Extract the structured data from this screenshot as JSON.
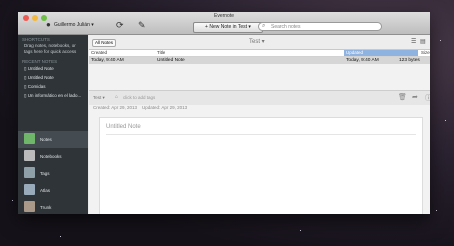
{
  "window": {
    "title": "Evernote"
  },
  "toolbar": {
    "account_label": "Guillermo Julián ▾",
    "new_note_label": "+ New Note in Test ▾",
    "search_placeholder": "Search notes",
    "search_icon": "search-icon",
    "sync_icon": "sync-icon",
    "activity_icon": "activity-icon"
  },
  "sidebar": {
    "shortcuts_header": "SHORTCUTS",
    "shortcuts_help": "Drag notes, notebooks, or tags here for quick access",
    "recent_header": "RECENT NOTES",
    "recent_notes": [
      {
        "label": "Untitled Note"
      },
      {
        "label": "Untitled Note"
      },
      {
        "label": "Comidas"
      },
      {
        "label": "Un informático en el lado..."
      }
    ],
    "nav": [
      {
        "label": "Notes"
      },
      {
        "label": "Notebooks"
      },
      {
        "label": "Tags"
      },
      {
        "label": "Atlas"
      },
      {
        "label": "Trunk"
      }
    ]
  },
  "list": {
    "filter_label": "All Notes",
    "notebook_label": "Test ▾",
    "columns": [
      "Created",
      "Title",
      "Updated",
      "Size"
    ],
    "rows": [
      {
        "created": "Today, 9:40 AM",
        "title": "Untitled Note",
        "updated": "Today, 9:40 AM",
        "size": "123 bytes"
      }
    ]
  },
  "editor": {
    "notebook": "Test ▾",
    "tags_placeholder": "click to add tags",
    "created": "Created: Apr 29, 2013",
    "updated": "Updated: Apr 29, 2013",
    "note_title_placeholder": "Untitled Note"
  },
  "colors": {
    "sidebar_bg": "#2e3438",
    "updated_column_highlight": "#8fb3e0",
    "close_button": "#ee5b52",
    "minimize_button": "#f3b93e",
    "zoom_button": "#6fbe45"
  }
}
